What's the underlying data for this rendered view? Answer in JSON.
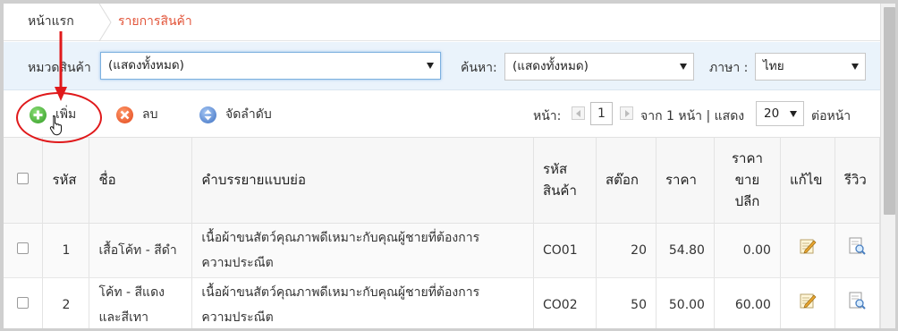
{
  "breadcrumb": {
    "home": "หน้าแรก",
    "current": "รายการสินค้า"
  },
  "filters": {
    "category_label": "หมวดสินค้า",
    "category_value": "(แสดงทั้งหมด)",
    "search_label": "ค้นหา:",
    "search_value": "(แสดงทั้งหมด)",
    "language_label": "ภาษา :",
    "language_value": "ไทย"
  },
  "toolbar": {
    "add_label": "เพิ่ม",
    "delete_label": "ลบ",
    "sort_label": "จัดลำดับ"
  },
  "pager": {
    "page_label": "หน้า:",
    "page_value": "1",
    "of_text": "จาก 1 หน้า | แสดง",
    "per_page_value": "20",
    "per_page_suffix": "ต่อหน้า"
  },
  "table": {
    "headers": {
      "id": "รหัส",
      "name": "ชื่อ",
      "desc": "คำบรรยายแบบย่อ",
      "code_l1": "รหัส",
      "code_l2": "สินค้า",
      "stock": "สต๊อก",
      "price": "ราคา",
      "retail_l1": "ราคา",
      "retail_l2": "ขาย",
      "retail_l3": "ปลีก",
      "edit": "แก้ไข",
      "review": "รีวิว"
    },
    "rows": [
      {
        "id": "1",
        "name_l1": "เสื้อโค้ท - สีดำ",
        "name_l2": "",
        "desc_l1": "เนื้อผ้าขนสัตว์คุณภาพดีเหมาะกับคุณผู้ชายที่ต้องการ",
        "desc_l2": "ความประณีต",
        "code": "CO01",
        "stock": "20",
        "price": "54.80",
        "retail": "0.00"
      },
      {
        "id": "2",
        "name_l1": "โค้ท - สีแดง",
        "name_l2": "และสีเทา",
        "desc_l1": "เนื้อผ้าขนสัตว์คุณภาพดีเหมาะกับคุณผู้ชายที่ต้องการ",
        "desc_l2": "ความประณีต",
        "code": "CO02",
        "stock": "50",
        "price": "50.00",
        "retail": "60.00"
      }
    ]
  },
  "icons": {
    "add": "plus-circle-icon",
    "delete": "x-circle-icon",
    "sort": "up-down-circle-icon",
    "edit": "pencil-note-icon",
    "review": "document-magnifier-icon"
  },
  "colors": {
    "breadcrumb_current": "#e2553a",
    "filter_bg": "#eaf3fb",
    "annotation": "#e0191b"
  }
}
